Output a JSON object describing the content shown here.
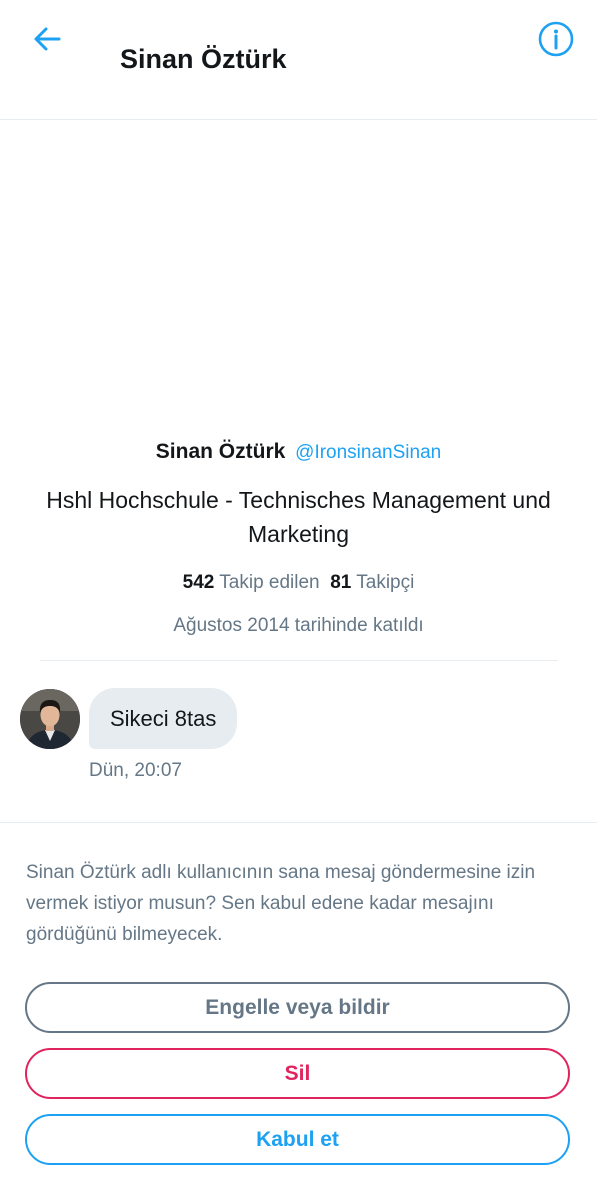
{
  "header": {
    "title": "Sinan Öztürk",
    "back_icon": "arrow-left-icon",
    "info_icon": "info-circle-icon"
  },
  "profile": {
    "name": "Sinan Öztürk",
    "handle": "@IronsinanSinan",
    "bio": "Hshl Hochschule - Technisches Management und Marketing",
    "following_count": "542",
    "following_label": "Takip edilen",
    "followers_count": "81",
    "followers_label": "Takipçi",
    "joined": "Ağustos 2014 tarihinde katıldı"
  },
  "message": {
    "text": "Sikeci 8tas",
    "time": "Dün, 20:07"
  },
  "request": {
    "text": "Sinan Öztürk adlı kullanıcının sana mesaj göndermesine izin vermek istiyor musun? Sen kabul edene kadar mesajını gördüğünü bilmeyecek.",
    "block_label": "Engelle veya bildir",
    "delete_label": "Sil",
    "accept_label": "Kabul et"
  },
  "colors": {
    "accent": "#1da1f2",
    "danger": "#e0245e",
    "muted": "#657786",
    "text": "#14171a",
    "divider": "#e6ecf0"
  }
}
